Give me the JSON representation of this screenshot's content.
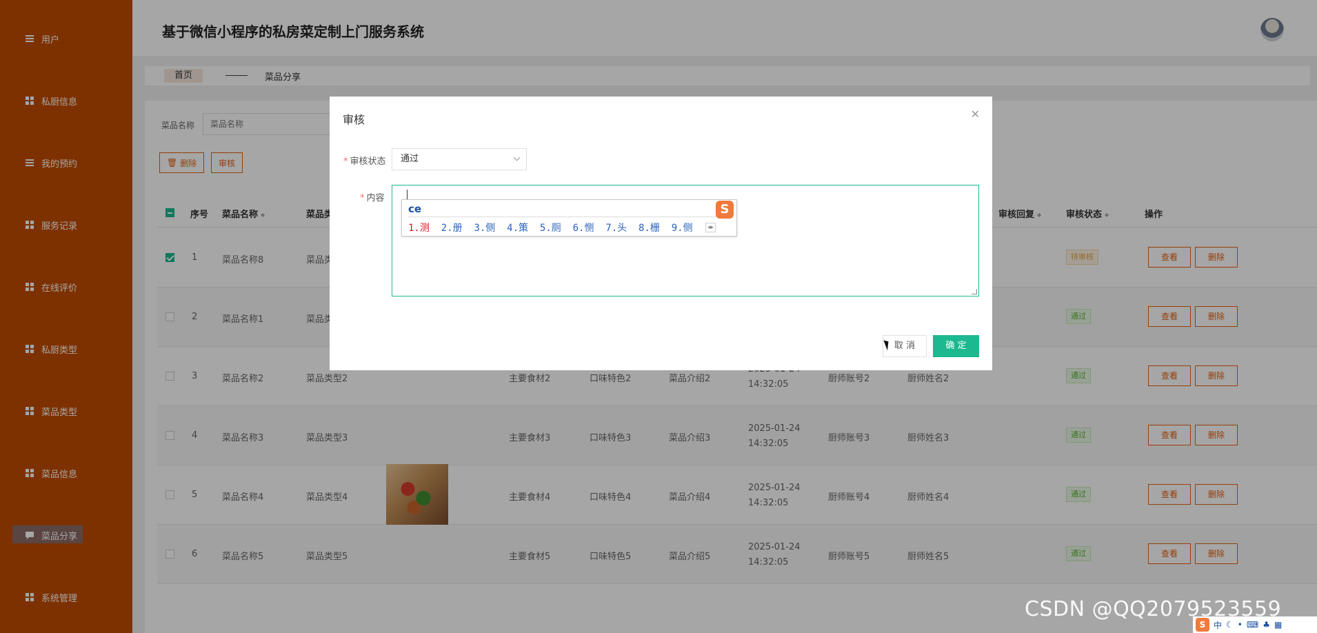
{
  "sidebar": {
    "items": [
      {
        "label": "用户",
        "icon": "list-icon"
      },
      {
        "label": "私厨信息",
        "icon": "grid-icon"
      },
      {
        "label": "我的预约",
        "icon": "list-icon"
      },
      {
        "label": "服务记录",
        "icon": "grid-icon"
      },
      {
        "label": "在线评价",
        "icon": "grid-icon"
      },
      {
        "label": "私厨类型",
        "icon": "grid-icon"
      },
      {
        "label": "菜品类型",
        "icon": "grid-icon"
      },
      {
        "label": "菜品信息",
        "icon": "grid-icon"
      },
      {
        "label": "菜品分享",
        "icon": "chat-icon"
      },
      {
        "label": "系统管理",
        "icon": "grid-icon"
      }
    ],
    "active_index": 8,
    "bg_color": "#c24c00"
  },
  "header": {
    "title": "基于微信小程序的私房菜定制上门服务系统"
  },
  "breadcrumb": {
    "home": "首页",
    "current": "菜品分享"
  },
  "search": {
    "label": "菜品名称",
    "placeholder": "菜品名称"
  },
  "toolbar": {
    "delete_label": "删除",
    "audit_label": "审核"
  },
  "table": {
    "headers": {
      "index": "序号",
      "name": "菜品名称",
      "type": "菜品类",
      "reply": "审核回复",
      "status": "审核状态",
      "ops": "操作"
    },
    "rows": [
      {
        "idx": "1",
        "name": "菜品名称8",
        "type": "菜品类",
        "ingredient": "",
        "flavor": "",
        "intro": "",
        "time": "",
        "account": "",
        "chef": "",
        "status": "待审核",
        "checked": true
      },
      {
        "idx": "2",
        "name": "菜品名称1",
        "type": "菜品类",
        "ingredient": "",
        "flavor": "",
        "intro": "",
        "time": "",
        "account": "",
        "chef": "",
        "status": "通过",
        "checked": false
      },
      {
        "idx": "3",
        "name": "菜品名称2",
        "type": "菜品类型2",
        "ingredient": "主要食材2",
        "flavor": "口味特色2",
        "intro": "菜品介绍2",
        "time": "2025-01-24 14:32:05",
        "account": "厨师账号2",
        "chef": "厨师姓名2",
        "status": "通过",
        "checked": false
      },
      {
        "idx": "4",
        "name": "菜品名称3",
        "type": "菜品类型3",
        "ingredient": "主要食材3",
        "flavor": "口味特色3",
        "intro": "菜品介绍3",
        "time": "2025-01-24 14:32:05",
        "account": "厨师账号3",
        "chef": "厨师姓名3",
        "status": "通过",
        "checked": false
      },
      {
        "idx": "5",
        "name": "菜品名称4",
        "type": "菜品类型4",
        "ingredient": "主要食材4",
        "flavor": "口味特色4",
        "intro": "菜品介绍4",
        "time": "2025-01-24 14:32:05",
        "account": "厨师账号4",
        "chef": "厨师姓名4",
        "status": "通过",
        "checked": false
      },
      {
        "idx": "6",
        "name": "菜品名称5",
        "type": "菜品类型5",
        "ingredient": "主要食材5",
        "flavor": "口味特色5",
        "intro": "菜品介绍5",
        "time": "2025-01-24 14:32:05",
        "account": "厨师账号5",
        "chef": "厨师姓名5",
        "status": "通过",
        "checked": false
      }
    ],
    "view_label": "查看",
    "delete_label": "删除"
  },
  "dialog": {
    "title": "审核",
    "status_label": "审核状态",
    "status_value": "通过",
    "content_label": "内容",
    "cancel_label": "取 消",
    "ok_label": "确 定"
  },
  "ime": {
    "pinyin": "ce",
    "logo": "S",
    "candidates": [
      "1.测",
      "2.册",
      "3.侧",
      "4.策",
      "5.厕",
      "6.恻",
      "7.头",
      "8.栅",
      "9.侧"
    ]
  },
  "watermark": "CSDN @QQ2079523559",
  "tray": {
    "ime_mode": "中"
  },
  "colors": {
    "accent": "#e6600f",
    "primary": "#1cb88f"
  }
}
